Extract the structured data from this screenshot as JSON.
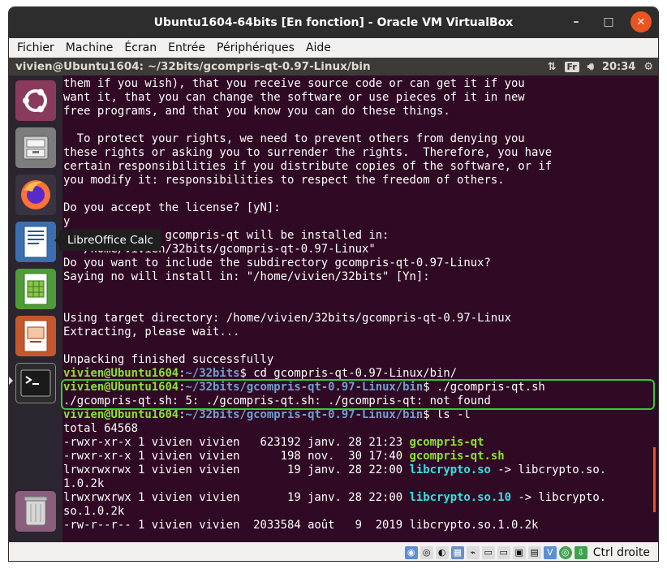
{
  "window": {
    "title": "Ubuntu1604-64bits [En fonction] - Oracle VM VirtualBox",
    "minimize": "–",
    "maximize": "□",
    "close": "✕"
  },
  "menubar": [
    "Fichier",
    "Machine",
    "Écran",
    "Entrée",
    "Périphériques",
    "Aide"
  ],
  "guest_topbar": {
    "title": "vivien@Ubuntu1604: ~/32bits/gcompris-qt-0.97-Linux/bin",
    "keyboard": "Fr",
    "clock": "20:34"
  },
  "launcher": {
    "tooltip": "LibreOffice Calc"
  },
  "terminal": {
    "lines": [
      "them if you wish), that you receive source code or can get it if you",
      "want it, that you can change the software or use pieces of it in new",
      "free programs, and that you know you can do these things.",
      "",
      "  To protect your rights, we need to prevent others from denying you",
      "these rights or asking you to surrender the rights.  Therefore, you have",
      "certain responsibilities if you distribute copies of the software, or if",
      "you modify it: responsibilities to respect the freedom of others.",
      "",
      "Do you accept the license? [yN]:",
      "y",
      "By default the gcompris-qt will be installed in:",
      "  \"/home/vivien/32bits/gcompris-qt-0.97-Linux\"",
      "Do you want to include the subdirectory gcompris-qt-0.97-Linux?",
      "Saying no will install in: \"/home/vivien/32bits\" [Yn]:",
      "",
      "",
      "Using target directory: /home/vivien/32bits/gcompris-qt-0.97-Linux",
      "Extracting, please wait...",
      "",
      "Unpacking finished successfully"
    ],
    "prompt_user": "vivien@Ubuntu1604",
    "prompt_sep": ":",
    "prompt_path_home": "~/32bits",
    "prompt_path_bin": "~/32bits/gcompris-qt-0.97-Linux/bin",
    "prompt_dollar": "$ ",
    "cmd1": "cd gcompris-qt-0.97-Linux/bin/",
    "cmd2": "./gcompris-qt.sh",
    "error": "./gcompris-qt.sh: 5: ./gcompris-qt.sh: ./gcompris-qt: not found",
    "cmd3": "ls -l",
    "total": "total 64568",
    "ls": [
      {
        "pre": "-rwxr-xr-x 1 vivien vivien   623192 janv. 28 21:23 ",
        "name": "gcompris-qt",
        "kind": "exe",
        "post": ""
      },
      {
        "pre": "-rwxr-xr-x 1 vivien vivien      198 nov.  30 17:40 ",
        "name": "gcompris-qt.sh",
        "kind": "exe",
        "post": ""
      },
      {
        "pre": "lrwxrwxrwx 1 vivien vivien       19 janv. 28 22:00 ",
        "name": "libcrypto.so",
        "kind": "lnk",
        "post": " -> libcrypto.so."
      },
      {
        "pre": "1.0.2k",
        "name": "",
        "kind": "",
        "post": ""
      },
      {
        "pre": "lrwxrwxrwx 1 vivien vivien       19 janv. 28 22:00 ",
        "name": "libcrypto.so.10",
        "kind": "lnk",
        "post": " -> libcrypto."
      },
      {
        "pre": "so.1.0.2k",
        "name": "",
        "kind": "",
        "post": ""
      },
      {
        "pre": "-rw-r--r-- 1 vivien vivien  2033584 août   9  2019 libcrypto.so.1.0.2k",
        "name": "",
        "kind": "",
        "post": ""
      }
    ]
  },
  "statusbar": {
    "host_key": "Ctrl droite"
  },
  "colors": {
    "terminal_bg": "#300a24",
    "prompt_user": "#8ae234",
    "prompt_path": "#729fcf",
    "symlink": "#34e2e2",
    "highlight": "#33cc33",
    "ubuntu_orange": "#e95420"
  }
}
